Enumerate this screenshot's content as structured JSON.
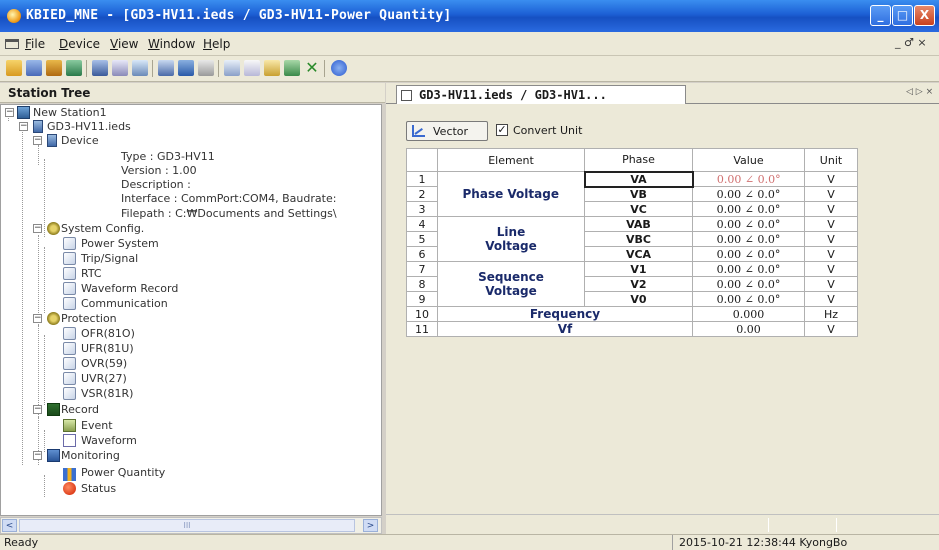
{
  "window": {
    "title": "KBIED_MNE - [GD3-HV11.ieds / GD3-HV11-Power Quantity]",
    "controls": {
      "min": "_",
      "max": "□",
      "close": "X"
    }
  },
  "menu": {
    "items": [
      "File",
      "Device",
      "View",
      "Window",
      "Help"
    ],
    "mdi_controls": "_ ♂ ×"
  },
  "toolbar": {
    "buttons": [
      "open-icon",
      "save-icon",
      "connect-icon",
      "network-icon",
      "tree-icon",
      "download-icon",
      "upload-icon",
      "settings-icon",
      "monitor-icon",
      "list-icon",
      "window-icon",
      "curve-icon",
      "curve2-icon",
      "export-icon",
      "close-x-icon",
      "help-icon"
    ]
  },
  "station_tree": {
    "header": "Station Tree",
    "nodes": {
      "station": "New Station1",
      "ieds": "GD3-HV11.ieds",
      "device": "Device",
      "type": "Type : GD3-HV11",
      "version": "Version : 1.00",
      "description": "Description :",
      "interface": "Interface : CommPort:COM4, Baudrate:",
      "filepath": "Filepath : C:₩Documents and Settings\\",
      "system_config": "System Config.",
      "power_system": "Power System",
      "trip_signal": "Trip/Signal",
      "rtc": "RTC",
      "waveform_record": "Waveform Record",
      "communication": "Communication",
      "protection": "Protection",
      "ofr": "OFR(81O)",
      "ufr": "UFR(81U)",
      "ovr": "OVR(59)",
      "uvr": "UVR(27)",
      "vsr": "VSR(81R)",
      "record": "Record",
      "event": "Event",
      "waveform": "Waveform",
      "monitoring": "Monitoring",
      "power_quantity": "Power Quantity",
      "status": "Status"
    },
    "scroll_left": "<",
    "scroll_right": ">",
    "scroll_thumb": "III"
  },
  "tabs": {
    "active": "GD3-HV11.ieds / GD3-HV1...",
    "nav": "◁ ▷ ×"
  },
  "power_quantity": {
    "vector_button": "Vector",
    "convert_checkbox": {
      "checked": true,
      "mark": "✓",
      "label": "Convert Unit"
    },
    "columns": [
      "Element",
      "Phase",
      "Value",
      "Unit"
    ],
    "groups": {
      "phase_voltage": "Phase Voltage",
      "line_voltage": "Line\nVoltage",
      "sequence_voltage": "Sequence\nVoltage",
      "frequency": "Frequency",
      "vf": "Vf"
    },
    "rows": [
      {
        "n": "1",
        "phase": "VA",
        "value": "0.00 ∠ 0.0°",
        "unit": "V"
      },
      {
        "n": "2",
        "phase": "VB",
        "value": "0.00 ∠ 0.0°",
        "unit": "V"
      },
      {
        "n": "3",
        "phase": "VC",
        "value": "0.00 ∠ 0.0°",
        "unit": "V"
      },
      {
        "n": "4",
        "phase": "VAB",
        "value": "0.00 ∠ 0.0°",
        "unit": "V"
      },
      {
        "n": "5",
        "phase": "VBC",
        "value": "0.00 ∠ 0.0°",
        "unit": "V"
      },
      {
        "n": "6",
        "phase": "VCA",
        "value": "0.00 ∠ 0.0°",
        "unit": "V"
      },
      {
        "n": "7",
        "phase": "V1",
        "value": "0.00 ∠ 0.0°",
        "unit": "V"
      },
      {
        "n": "8",
        "phase": "V2",
        "value": "0.00 ∠ 0.0°",
        "unit": "V"
      },
      {
        "n": "9",
        "phase": "V0",
        "value": "0.00 ∠ 0.0°",
        "unit": "V"
      },
      {
        "n": "10",
        "value": "0.000",
        "unit": "Hz"
      },
      {
        "n": "11",
        "value": "0.00",
        "unit": "V"
      }
    ]
  },
  "statusbar": {
    "left": "Ready",
    "right": "2015-10-21 12:38:44  KyongBo"
  },
  "colors": {
    "titlebar": "#1c5fd4",
    "selected_value": "#d07070",
    "element_label": "#1a2a6a"
  }
}
